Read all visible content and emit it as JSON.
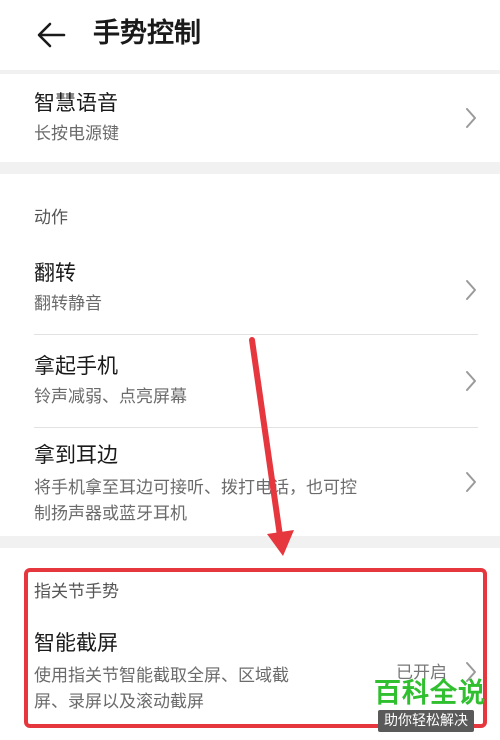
{
  "header": {
    "title": "手势控制"
  },
  "voice": {
    "title": "智慧语音",
    "subtitle": "长按电源键"
  },
  "actions": {
    "section_label": "动作",
    "items": [
      {
        "title": "翻转",
        "subtitle": "翻转静音"
      },
      {
        "title": "拿起手机",
        "subtitle": "铃声减弱、点亮屏幕"
      },
      {
        "title": "拿到耳边",
        "subtitle_line1": "将手机拿至耳边可接听、拨打电话，也可控",
        "subtitle_line2": "制扬声器或蓝牙耳机"
      }
    ]
  },
  "knuckle": {
    "section_label": "指关节手势",
    "item": {
      "title": "智能截屏",
      "subtitle_line1": "使用指关节智能截取全屏、区域截",
      "subtitle_line2": "屏、录屏以及滚动截屏",
      "status": "已开启"
    }
  },
  "watermark": {
    "main": "百科全说",
    "sub": "助你轻松解决"
  },
  "colors": {
    "highlight": "#e6373f",
    "watermark_green": "#2fbf2f"
  }
}
